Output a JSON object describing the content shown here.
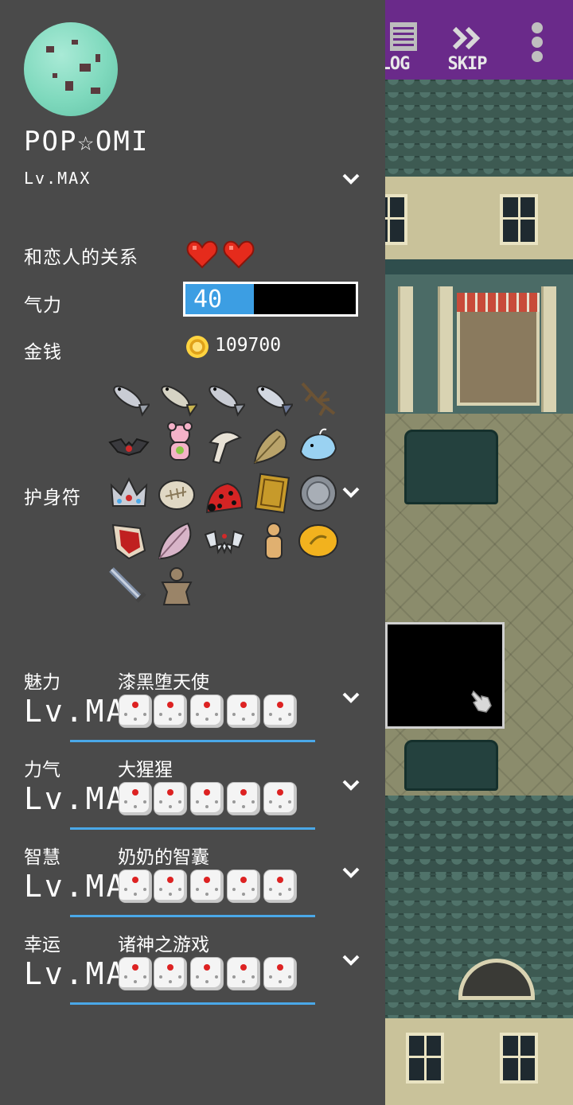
{
  "topbar": {
    "log_label": "LOG",
    "skip_label": "SKIP"
  },
  "profile": {
    "name": "POP☆OMI",
    "level": "Lv.MAX"
  },
  "status": {
    "relationship_label": "和恋人的关系",
    "relationship_hearts": 2,
    "energy_label": "气力",
    "energy_value": "40",
    "energy_fraction": 0.4,
    "money_label": "金钱",
    "money_value": "109700"
  },
  "charms": {
    "label": "护身符",
    "items": [
      "fish-icon",
      "fish-icon",
      "fish-icon",
      "fish-icon",
      "branch-icon",
      "bat-icon",
      "bear-plush-icon",
      "mushroom-icon",
      "leaf-icon",
      "whale-icon",
      "crown-icon",
      "fossil-icon",
      "ladybug-icon",
      "book-icon",
      "coin-icon",
      "shield-icon",
      "feather-icon",
      "fang-icon",
      "figurine-icon",
      "amber-icon",
      "sword-icon",
      "clay-doll-icon"
    ]
  },
  "stats": [
    {
      "name": "魅力",
      "title": "漆黑堕天使",
      "level": "Lv.MAX",
      "dice": 5
    },
    {
      "name": "力气",
      "title": "大猩猩",
      "level": "Lv.MAX",
      "dice": 5
    },
    {
      "name": "智慧",
      "title": "奶奶的智囊",
      "level": "Lv.MAX",
      "dice": 5
    },
    {
      "name": "幸运",
      "title": "诸神之游戏",
      "level": "Lv.MAX",
      "dice": 5
    }
  ],
  "colors": {
    "panel_bg": "#4a4a4a",
    "topbar_purple": "#6a2a8a",
    "energy_blue": "#3c9ee3",
    "heart_red": "#e52b1c",
    "stat_line_blue": "#4aa8e8"
  }
}
